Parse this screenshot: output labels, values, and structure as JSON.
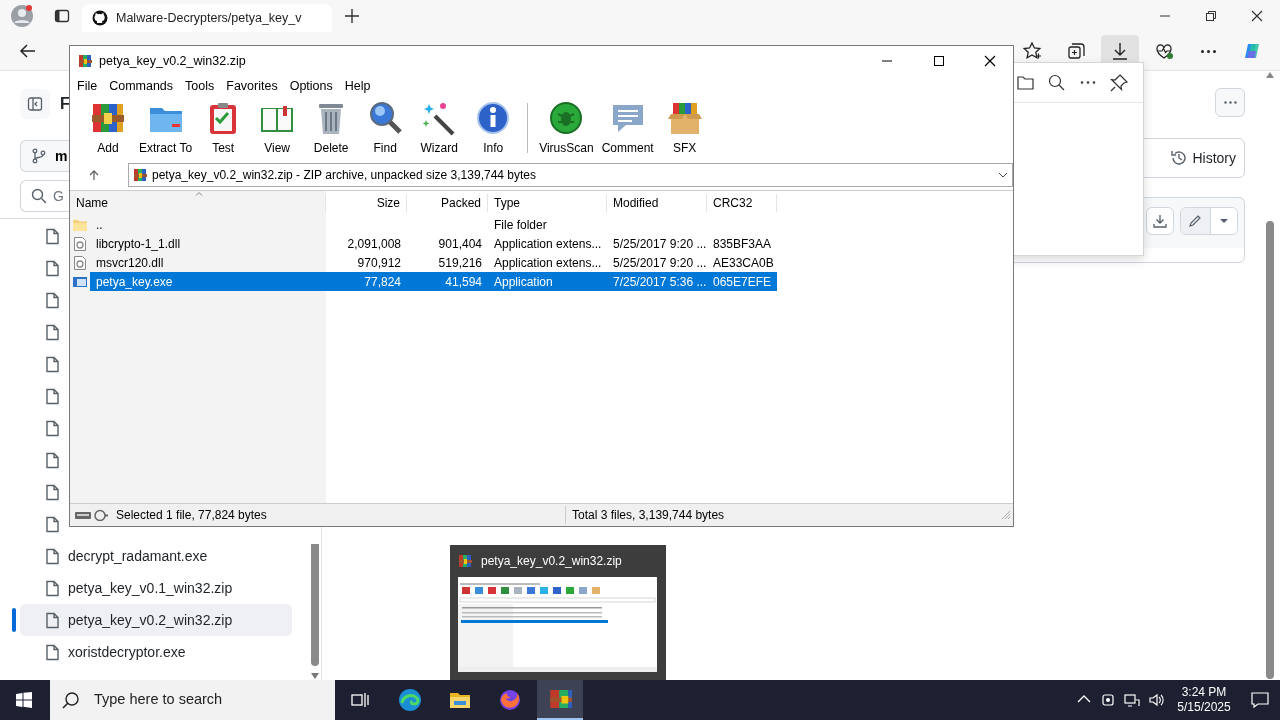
{
  "browser": {
    "tabs": [
      {
        "title": "Malware-Decrypters/petya_key_v",
        "selected": true
      }
    ],
    "sidebar": {
      "title": "F",
      "branch": "m",
      "search_placeholder": "G",
      "files": [
        {
          "selected": false
        },
        {
          "selected": false
        },
        {
          "selected": false
        },
        {
          "selected": false
        },
        {
          "selected": false
        },
        {
          "selected": false
        },
        {
          "selected": false
        },
        {
          "selected": false
        },
        {
          "selected": false
        },
        {
          "selected": false
        },
        {
          "name": "decrypt_radamant.exe",
          "selected": false
        },
        {
          "name": "petya_key_v0.1_win32.zip",
          "selected": false
        },
        {
          "name": "petya_key_v0.2_win32.zip",
          "selected": true
        },
        {
          "name": "xoristdecryptor.exe",
          "selected": false
        }
      ]
    },
    "history_button": "History"
  },
  "winrar": {
    "title": "petya_key_v0.2_win32.zip",
    "menu": [
      "File",
      "Commands",
      "Tools",
      "Favorites",
      "Options",
      "Help"
    ],
    "toolbar": [
      "Add",
      "Extract To",
      "Test",
      "View",
      "Delete",
      "Find",
      "Wizard",
      "Info",
      "VirusScan",
      "Comment",
      "SFX"
    ],
    "address": "petya_key_v0.2_win32.zip - ZIP archive, unpacked size 3,139,744 bytes",
    "columns": [
      "Name",
      "Size",
      "Packed",
      "Type",
      "Modified",
      "CRC32"
    ],
    "rows": [
      {
        "kind": "folder",
        "name": "..",
        "type": "File folder",
        "selected": false
      },
      {
        "kind": "dll",
        "name": "libcrypto-1_1.dll",
        "size": "2,091,008",
        "packed": "901,404",
        "type": "Application extens...",
        "modified": "5/25/2017 9:20 ...",
        "crc": "835BF3AA",
        "selected": false
      },
      {
        "kind": "dll",
        "name": "msvcr120.dll",
        "size": "970,912",
        "packed": "519,216",
        "type": "Application extens...",
        "modified": "5/25/2017 9:20 ...",
        "crc": "AE33CA0B",
        "selected": false
      },
      {
        "kind": "exe",
        "name": "petya_key.exe",
        "size": "77,824",
        "packed": "41,594",
        "type": "Application",
        "modified": "7/25/2017 5:36 ...",
        "crc": "065E7EFE",
        "selected": true
      }
    ],
    "status_left": "Selected 1 file, 77,824 bytes",
    "status_right": "Total 3 files, 3,139,744 bytes"
  },
  "taskbar_preview": {
    "title": "petya_key_v0.2_win32.zip"
  },
  "taskbar": {
    "search_placeholder": "Type here to search",
    "apps": [
      {
        "selected": false
      },
      {
        "selected": false
      },
      {
        "selected": false
      },
      {
        "selected": true
      }
    ],
    "time": "3:24 PM",
    "date": "5/15/2025"
  }
}
